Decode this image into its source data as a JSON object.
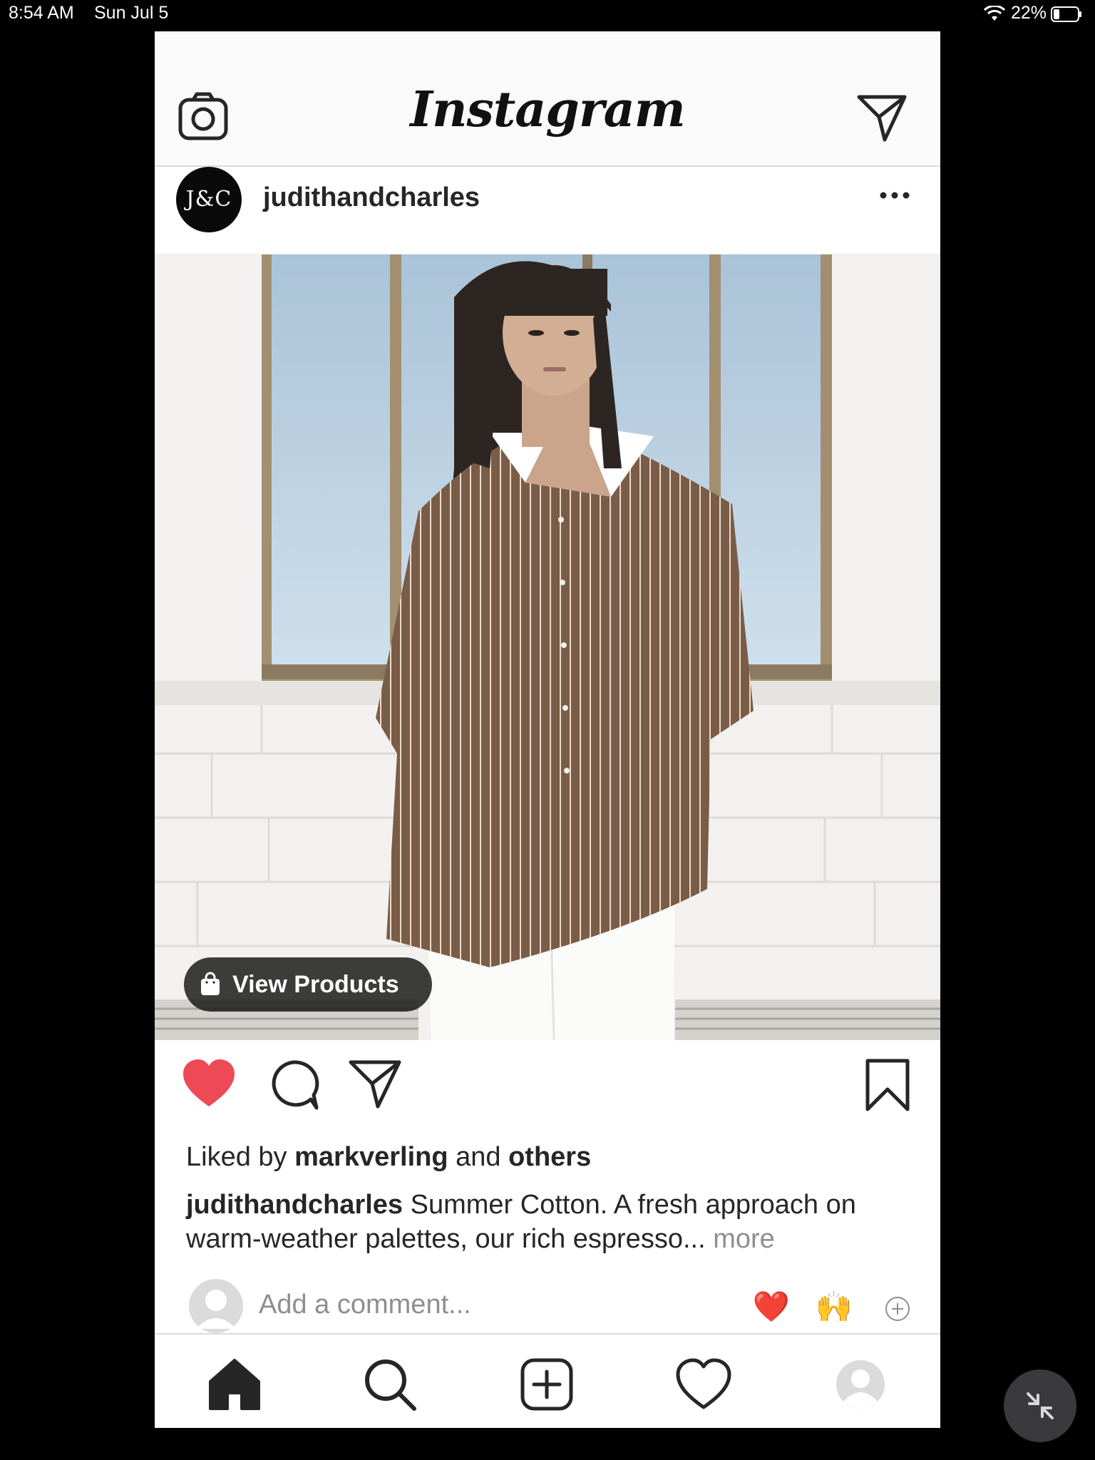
{
  "status_bar": {
    "time": "8:54 AM",
    "date": "Sun Jul 5",
    "battery": "22%"
  },
  "header": {
    "logo": "Instagram",
    "camera_icon": "camera-icon",
    "direct_icon": "paper-plane-icon"
  },
  "post": {
    "avatar_text": "J&C",
    "username": "judithandcharles",
    "shop_button": "View Products",
    "likes": {
      "prefix": "Liked by",
      "user": "markverling",
      "middle": "and",
      "others": "others"
    },
    "caption": {
      "user": "judithandcharles",
      "text": "Summer Cotton. A fresh approach on warm-weather palettes, our rich espresso...",
      "more": "more"
    },
    "comment": {
      "placeholder": "Add a comment...",
      "quick_reactions": [
        "❤️",
        "🙌"
      ]
    },
    "liked": true
  },
  "tabs": [
    "home",
    "search",
    "new-post",
    "activity",
    "profile"
  ],
  "colors": {
    "like_red": "#ed4956",
    "text": "#262626",
    "muted": "#8e8e8e",
    "divider": "#dbdbdb"
  }
}
